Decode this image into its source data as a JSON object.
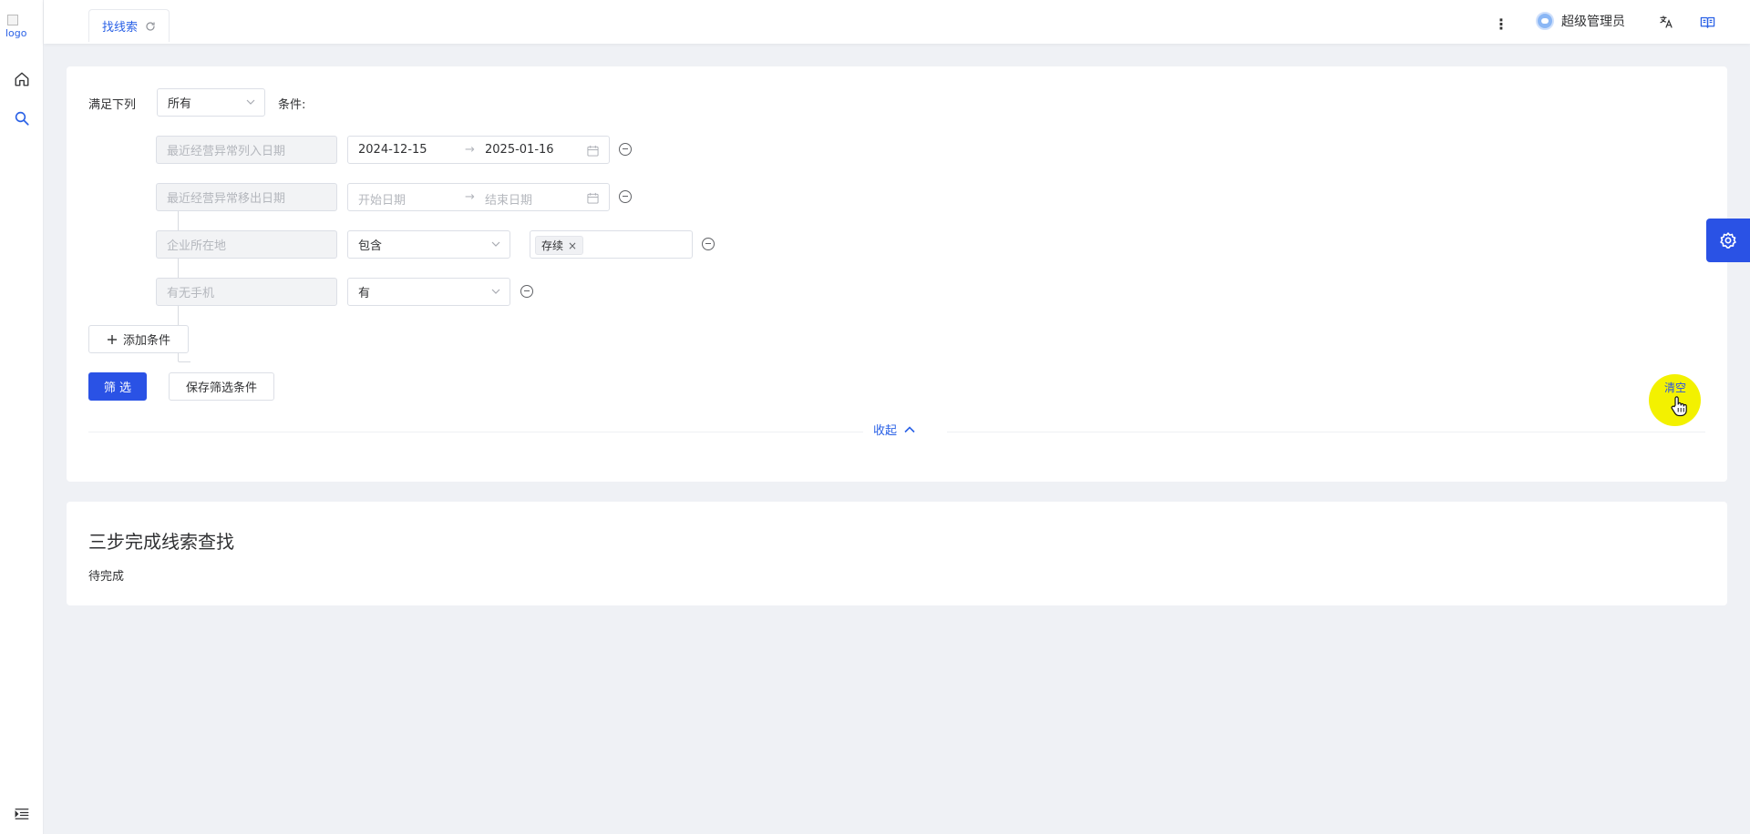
{
  "logo": {
    "alt_text": "logo"
  },
  "sidebar": {
    "items": [
      {
        "name": "home",
        "icon": "home-icon"
      },
      {
        "name": "search",
        "icon": "search-icon"
      }
    ],
    "bottom_icon": "menu-indent-icon"
  },
  "header": {
    "tab_label": "找线索",
    "user_name": "超级管理员",
    "icons": [
      "more-vertical-icon",
      "translate-icon",
      "book-icon"
    ]
  },
  "filter": {
    "match_prefix": "满足下列",
    "match_value": "所有",
    "match_suffix": "条件:",
    "conditions": [
      {
        "field": "最近经营异常列入日期",
        "start": "2024-12-15",
        "arrow": "→",
        "end": "2025-01-16"
      },
      {
        "field": "最近经营异常移出日期",
        "start_placeholder": "开始日期",
        "arrow": "→",
        "end_placeholder": "结束日期"
      },
      {
        "field": "企业所在地",
        "operator": "包含",
        "tag": "存续",
        "tag_close": "×"
      },
      {
        "field": "有无手机",
        "operator": "有"
      }
    ],
    "add_condition": "添加条件",
    "filter_button": "筛 选",
    "save_button": "保存筛选条件",
    "clear_link": "清空",
    "collapse_label": "收起"
  },
  "steps_panel": {
    "title": "三步完成线索查找",
    "status": "待完成"
  },
  "colors": {
    "primary": "#2a52e5",
    "link": "#2a61e6",
    "cursor_highlight": "#f3f100"
  }
}
